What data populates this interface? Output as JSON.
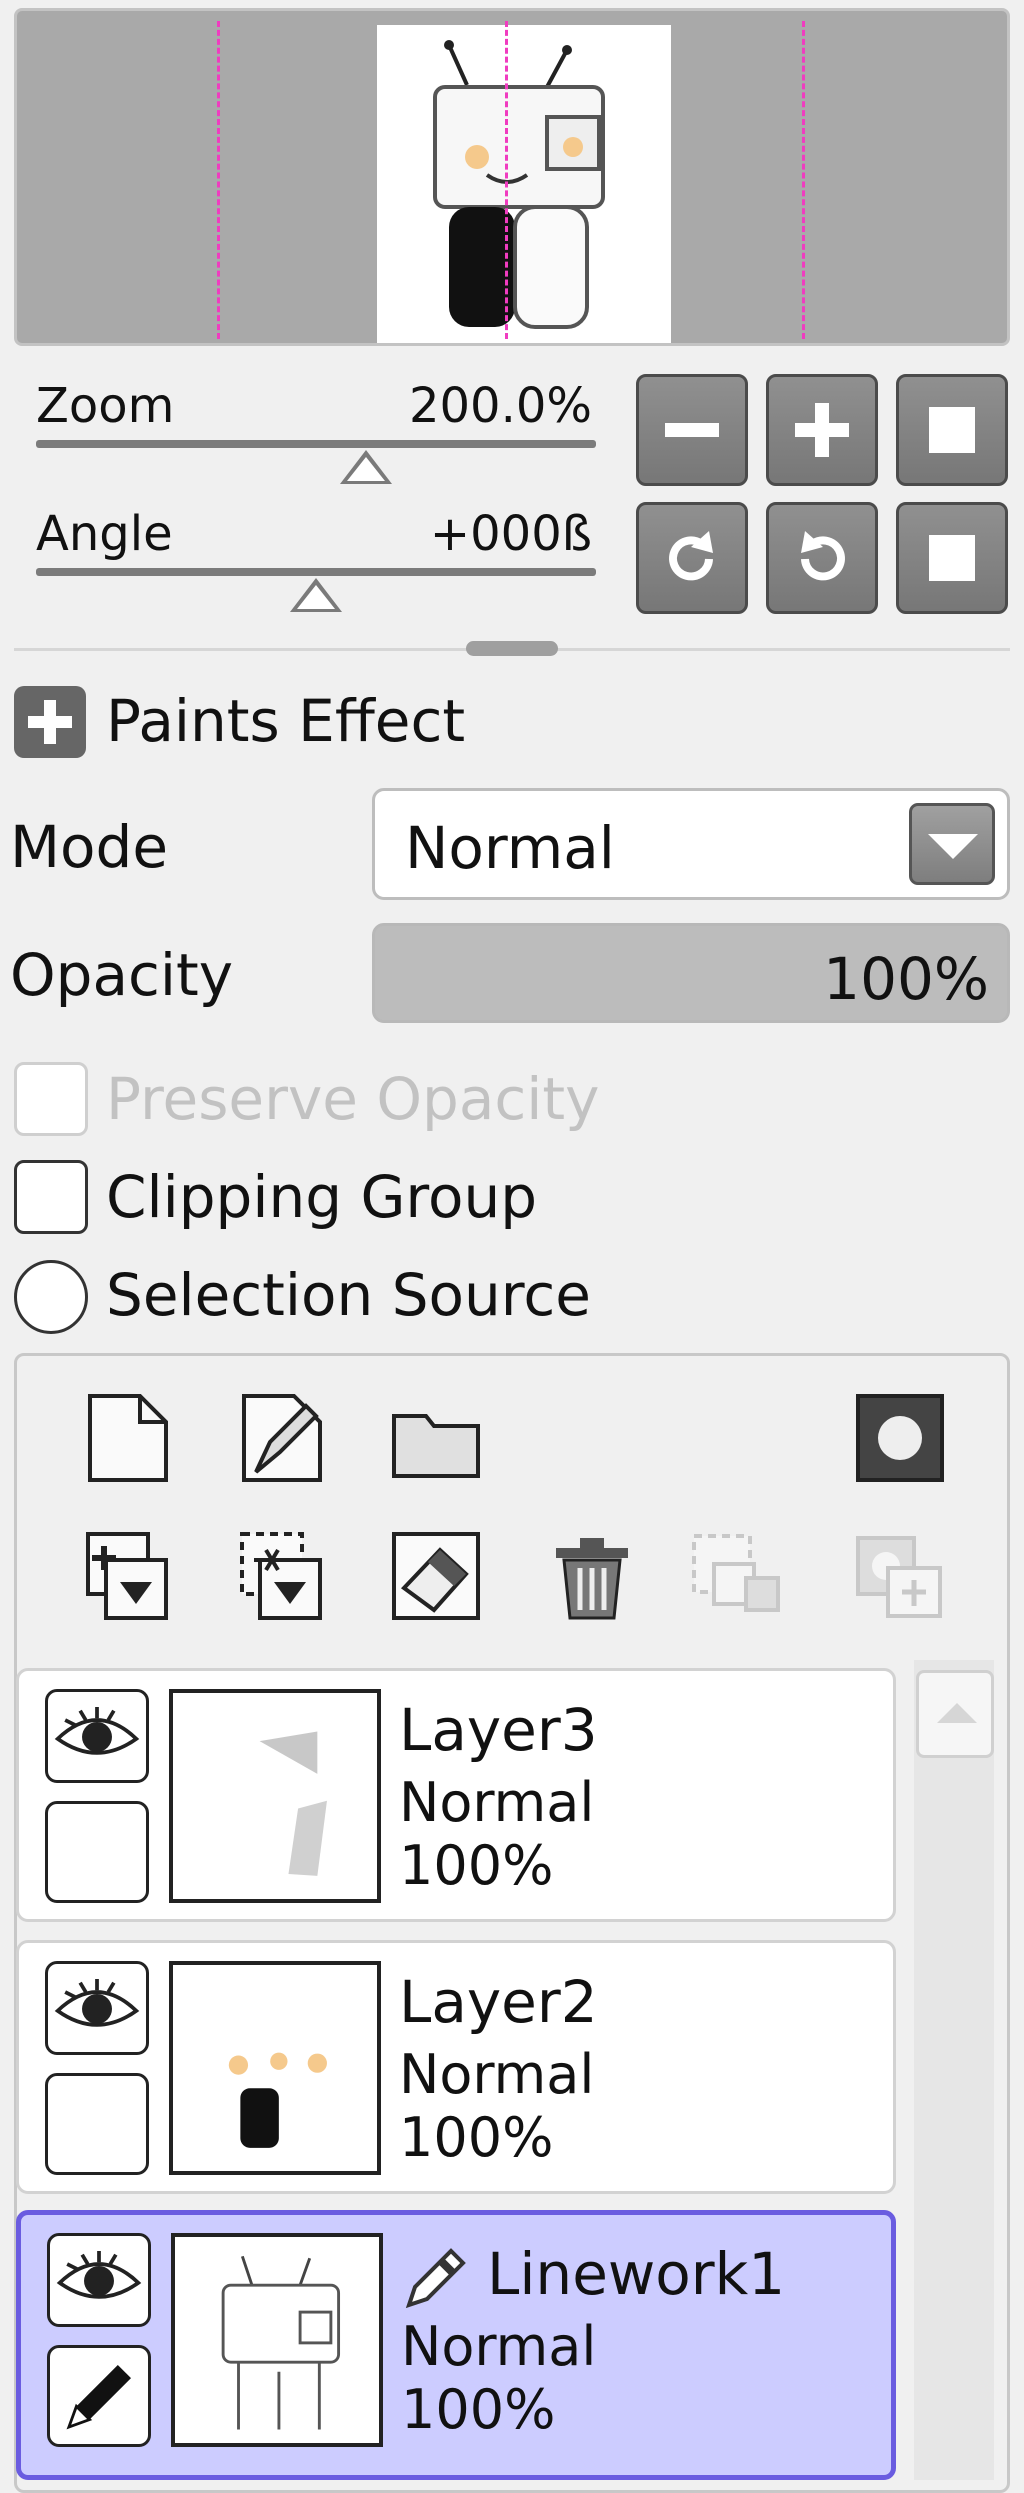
{
  "navigator": {
    "zoom": {
      "label": "Zoom",
      "value": "200.0%"
    },
    "angle": {
      "label": "Angle",
      "value": "+000ß"
    }
  },
  "properties": {
    "paints_effect_label": "Paints Effect",
    "mode": {
      "label": "Mode",
      "value": "Normal"
    },
    "opacity": {
      "label": "Opacity",
      "value": "100%",
      "fraction": 1.0
    },
    "preserve_opacity": {
      "label": "Preserve Opacity",
      "checked": false,
      "enabled": false
    },
    "clipping_group": {
      "label": "Clipping Group",
      "checked": false
    },
    "selection_source": {
      "label": "Selection Source",
      "checked": false
    }
  },
  "layers": [
    {
      "name": "Layer3",
      "mode": "Normal",
      "opacity": "100%",
      "visible": true,
      "selected": false
    },
    {
      "name": "Layer2",
      "mode": "Normal",
      "opacity": "100%",
      "visible": true,
      "selected": false
    },
    {
      "name": "Linework1",
      "mode": "Normal",
      "opacity": "100%",
      "visible": true,
      "selected": true
    }
  ],
  "colors": {
    "selected_layer_bg": "#ccccff",
    "selected_layer_border": "#6a5ce0",
    "guide_line": "#f03cc0"
  }
}
